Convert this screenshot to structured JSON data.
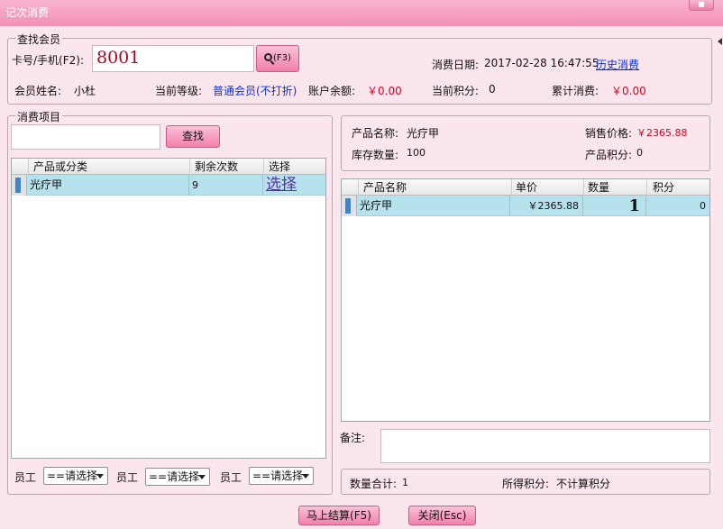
{
  "window": {
    "title": "记次消费"
  },
  "member": {
    "legend": "查找会员",
    "card_label": "卡号/手机(F2):",
    "card_value": "8001",
    "search_btn": "(F3)",
    "date_label": "消费日期:",
    "date_value": "2017-02-28 16:47:55",
    "history_link": "历史消费",
    "name_label": "会员姓名:",
    "name_value": "小杜",
    "level_label": "当前等级:",
    "level_value": "普通会员(不打折)",
    "balance_label": "账户余额:",
    "balance_value": "￥0.00",
    "points_label": "当前积分:",
    "points_value": "0",
    "total_label": "累计消费:",
    "total_value": "￥0.00"
  },
  "items": {
    "legend": "消费项目",
    "search_value": "",
    "search_btn": "查找",
    "columns": [
      "产品或分类",
      "剩余次数",
      "选择"
    ],
    "rows": [
      {
        "name": "光疗甲",
        "remaining": "9",
        "action": "选择"
      }
    ]
  },
  "staff": {
    "label1": "员工",
    "label2": "员工",
    "label3": "员工",
    "select1": "==请选择",
    "select2": "==请选择",
    "select3": "==请选择"
  },
  "product": {
    "name_label": "产品名称:",
    "name_value": "光疗甲",
    "price_label": "销售价格:",
    "price_value": "￥2365.88",
    "stock_label": "库存数量:",
    "stock_value": "100",
    "points_label": "产品积分:",
    "points_value": "0"
  },
  "cart": {
    "columns": [
      "产品名称",
      "单价",
      "数量",
      "积分"
    ],
    "rows": [
      {
        "name": "光疗甲",
        "price": "￥2365.88",
        "qty": "1",
        "points": "0"
      }
    ]
  },
  "remark": {
    "label": "备注:",
    "value": ""
  },
  "summary": {
    "qty_label": "数量合计:",
    "qty_value": "1",
    "points_label": "所得积分:",
    "points_value": "不计算积分"
  },
  "footer": {
    "checkout_btn": "马上结算(F5)",
    "close_btn": "关闭(Esc)"
  }
}
